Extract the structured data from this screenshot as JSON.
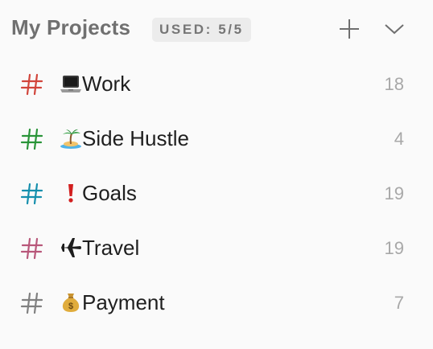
{
  "header": {
    "title": "My Projects",
    "usage_badge": "USED: 5/5",
    "add_icon": "plus-icon",
    "collapse_icon": "chevron-down-icon"
  },
  "projects": [
    {
      "hash_color": "#d1453b",
      "emoji_icon": "laptop-icon",
      "name": "Work",
      "count": "18"
    },
    {
      "hash_color": "#299438",
      "emoji_icon": "island-icon",
      "name": "Side Hustle",
      "count": "4"
    },
    {
      "hash_color": "#158fad",
      "emoji_icon": "exclamation-icon",
      "name": " Goals",
      "count": "19"
    },
    {
      "hash_color": "#b8577a",
      "emoji_icon": "airplane-icon",
      "name": "Travel",
      "count": "19"
    },
    {
      "hash_color": "#808080",
      "emoji_icon": "money-bag-icon",
      "name": "Payment",
      "count": "7"
    }
  ]
}
